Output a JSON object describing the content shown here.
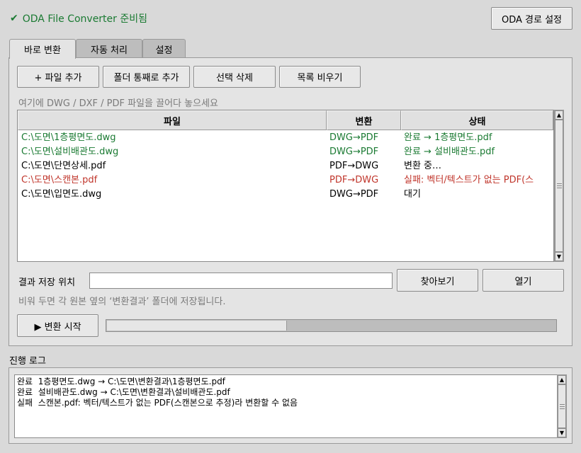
{
  "status": {
    "check": "✔",
    "text": "ODA File Converter 준비됨",
    "color": "#1a7a32"
  },
  "header": {
    "oda_path_button": "ODA 경로 설정"
  },
  "tabs": [
    {
      "label": "바로 변환",
      "active": true
    },
    {
      "label": "자동 처리",
      "active": false
    },
    {
      "label": "설정",
      "active": false
    }
  ],
  "toolbar": {
    "add_file": "+ 파일 추가",
    "add_folder": "폴더 통째로 추가",
    "delete_selected": "선택 삭제",
    "clear_list": "목록 비우기"
  },
  "drop_hint": "여기에 DWG / DXF / PDF 파일을 끌어다 놓으세요",
  "table": {
    "headers": [
      "파일",
      "변환",
      "상태"
    ],
    "rows": [
      {
        "file": "C:\\도면\\1층평면도.dwg",
        "conv": "DWG→PDF",
        "state": "완료 → 1층평면도.pdf",
        "kind": "ok"
      },
      {
        "file": "C:\\도면\\설비배관도.dwg",
        "conv": "DWG→PDF",
        "state": "완료 → 설비배관도.pdf",
        "kind": "ok"
      },
      {
        "file": "C:\\도면\\단면상세.pdf",
        "conv": "PDF→DWG",
        "state": "변환 중…",
        "kind": "normal"
      },
      {
        "file": "C:\\도면\\스캔본.pdf",
        "conv": "PDF→DWG",
        "state": "실패: 벡터/텍스트가 없는 PDF(스",
        "kind": "err"
      },
      {
        "file": "C:\\도면\\입면도.dwg",
        "conv": "DWG→PDF",
        "state": "대기",
        "kind": "normal"
      }
    ]
  },
  "output": {
    "label": "결과 저장 위치",
    "value": "",
    "browse": "찾아보기",
    "open": "열기",
    "hint": "비워 두면 각 원본 옆의 ‘변환결과’ 폴더에 저장됩니다."
  },
  "convert": {
    "start": "▶ 변환 시작",
    "progress": 0.4
  },
  "log": {
    "title": "진행 로그",
    "lines": [
      "완료  1층평면도.dwg → C:\\도면\\변환결과\\1층평면도.pdf",
      "완료  설비배관도.dwg → C:\\도면\\변환결과\\설비배관도.pdf",
      "실패  스캔본.pdf: 벡터/텍스트가 없는 PDF(스캔본으로 추정)라 변환할 수 없음"
    ]
  },
  "colors": {
    "ok": "#1a7a32",
    "error": "#c0352b",
    "muted": "#7a7a7a"
  },
  "icons": {
    "check": "check-icon",
    "scroll_up": "arrow-up-icon",
    "scroll_down": "arrow-down-icon"
  }
}
